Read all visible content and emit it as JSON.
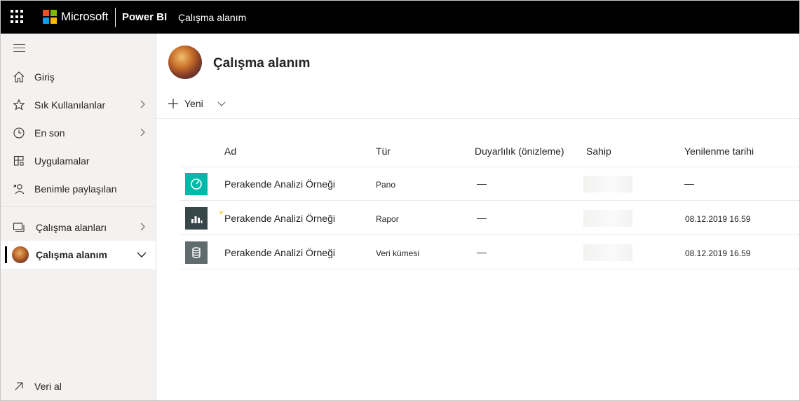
{
  "topbar": {
    "brand": "Microsoft",
    "product": "Power BI",
    "breadcrumb": "Çalışma alanım",
    "logo_colors": [
      "#f25022",
      "#7fba00",
      "#00a4ef",
      "#ffb900"
    ]
  },
  "sidebar": {
    "items": [
      {
        "label": "Giriş",
        "icon": "home-icon"
      },
      {
        "label": "Sık Kullanılanlar",
        "icon": "star-icon",
        "has_chevron": true
      },
      {
        "label": "En son",
        "icon": "clock-icon",
        "has_chevron": true
      },
      {
        "label": "Uygulamalar",
        "icon": "apps-icon"
      },
      {
        "label": "Benimle paylaşılan",
        "icon": "shared-person-icon"
      }
    ],
    "workspaces": {
      "label": "Çalışma alanları",
      "icon": "workspaces-icon"
    },
    "active_workspace": {
      "label": "Çalışma alanım"
    },
    "get_data": {
      "label": "Veri al",
      "icon": "arrow-up-right-icon"
    }
  },
  "main": {
    "title": "Çalışma alanım",
    "new_button": "Yeni",
    "columns": {
      "name": "Ad",
      "type": "Tür",
      "sensitivity": "Duyarlılık (önizleme)",
      "owner": "Sahip",
      "refreshed": "Yenilenme tarihi"
    },
    "rows": [
      {
        "name": "Perakende Analizi Örneği",
        "type": "Pano",
        "sensitivity": "—",
        "refreshed": "—",
        "icon": "dashboard-icon",
        "tile_color": "#01b8aa"
      },
      {
        "name": "Perakende Analizi Örneği",
        "type": "Rapor",
        "sensitivity": "—",
        "refreshed": "08.12.2019 16.59",
        "icon": "report-icon",
        "tile_color": "#374649"
      },
      {
        "name": "Perakende Analizi Örneği",
        "type": "Veri kümesi",
        "sensitivity": "—",
        "refreshed": "08.12.2019 16.59",
        "icon": "dataset-icon",
        "tile_color": "#5f6b6d"
      }
    ]
  }
}
